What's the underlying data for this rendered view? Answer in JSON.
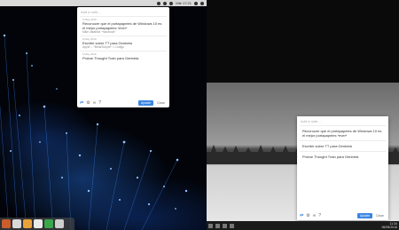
{
  "menubar": {
    "items": [
      "Mié 17:21"
    ]
  },
  "notes_app": {
    "input_placeholder": "Add a note...",
    "notes": [
      {
        "date": "6 May 2016",
        "text": "Reconocer que el portapapeles de Windows 10 es el mejor portapapeles *ever*",
        "sub": "Mike databilor *macbook*"
      },
      {
        "date": "6 May 2016",
        "text": "Escribir sobre TT para Genbeta",
        "sub": "Apple -- *Beta/Scripts* = Codigo"
      },
      {
        "date": "6 May 2016",
        "text": "Probar Thought Train para Genbeta",
        "sub": ""
      }
    ],
    "footer": {
      "primary_label": "Update",
      "secondary_label": "Close"
    }
  },
  "windows_notes_app": {
    "input_placeholder": "Add a note...",
    "notes": [
      {
        "text": "Reconocer que el portapapeles de Windows 10 es el mejor portapapeles *ever*"
      },
      {
        "text": "Escribir sobre TT para Genbeta"
      },
      {
        "text": "Probar Thought Train para Genbeta"
      }
    ],
    "footer": {
      "primary_label": "Update",
      "secondary_label": "Close"
    }
  },
  "taskbar": {
    "time": "11:34",
    "date": "06/05/2016"
  }
}
